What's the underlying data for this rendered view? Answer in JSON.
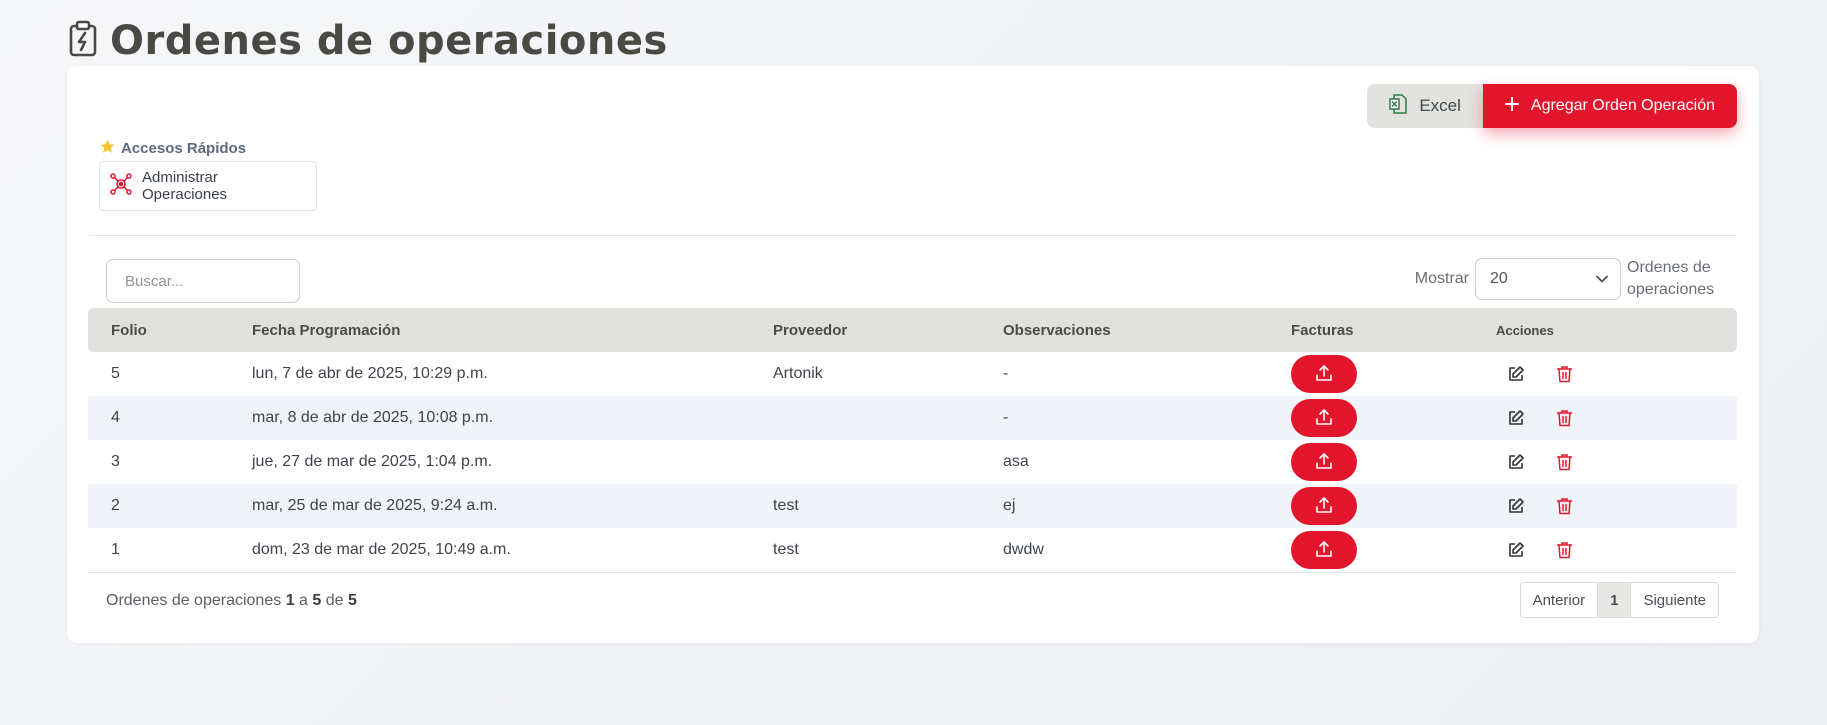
{
  "header": {
    "title": "Ordenes de operaciones",
    "icon": "clipboard-bolt-icon"
  },
  "actions": {
    "excel_label": "Excel",
    "add_label": "Agregar Orden Operación"
  },
  "quick_access": {
    "label": "Accesos Rápidos",
    "items": [
      {
        "label": "Administrar Operaciones",
        "icon": "operations-hub-icon"
      }
    ]
  },
  "search": {
    "placeholder": "Buscar...",
    "value": ""
  },
  "show": {
    "prefix": "Mostrar",
    "selected": "20",
    "suffix": "Ordenes de operaciones"
  },
  "table": {
    "columns": [
      "Folio",
      "Fecha Programación",
      "Proveedor",
      "Observaciones",
      "Facturas",
      "Acciones"
    ],
    "rows": [
      {
        "folio": "5",
        "fecha": "lun, 7 de abr de 2025, 10:29 p.m.",
        "proveedor": "Artonik",
        "observaciones": "-"
      },
      {
        "folio": "4",
        "fecha": "mar, 8 de abr de 2025, 10:08 p.m.",
        "proveedor": "",
        "observaciones": "-"
      },
      {
        "folio": "3",
        "fecha": "jue, 27 de mar de 2025, 1:04 p.m.",
        "proveedor": "",
        "observaciones": "asa"
      },
      {
        "folio": "2",
        "fecha": "mar, 25 de mar de 2025, 9:24 a.m.",
        "proveedor": "test",
        "observaciones": "ej"
      },
      {
        "folio": "1",
        "fecha": "dom, 23 de mar de 2025, 10:49 a.m.",
        "proveedor": "test",
        "observaciones": "dwdw"
      }
    ]
  },
  "footer": {
    "prefix": "Ordenes de operaciones",
    "from": "1",
    "a": "a",
    "to": "5",
    "de": "de",
    "total": "5"
  },
  "pagination": {
    "prev": "Anterior",
    "current": "1",
    "next": "Siguiente"
  },
  "colors": {
    "accent": "#e3152c",
    "header_bg": "#e0e0dc",
    "row_alt": "#f0f3f7"
  }
}
